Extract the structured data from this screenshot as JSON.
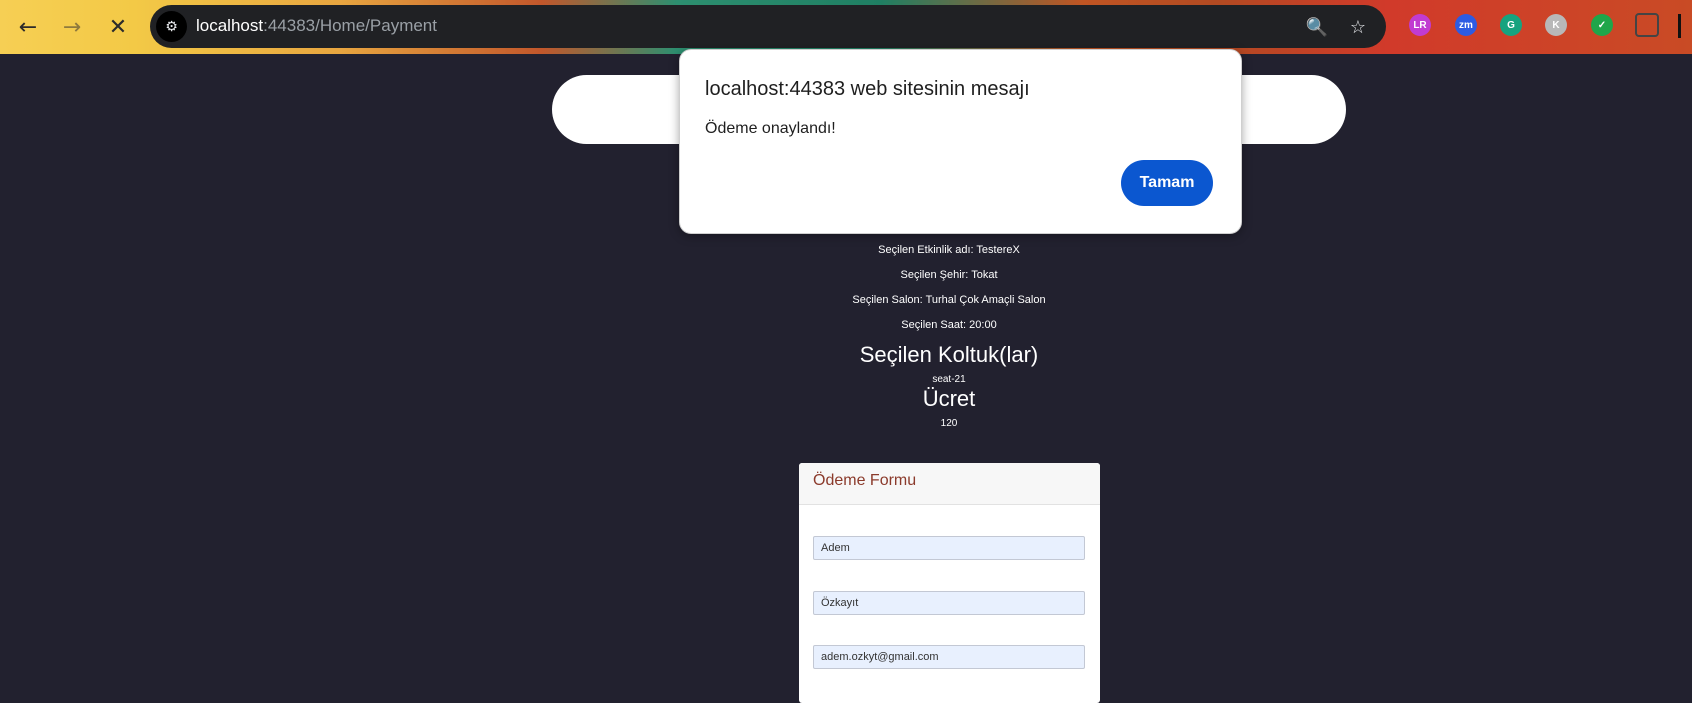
{
  "browser": {
    "url_host": "localhost",
    "url_path": ":44383/Home/Payment",
    "extensions": [
      {
        "name": "lr-extension-icon",
        "label": "LR",
        "color": "#c13bd1"
      },
      {
        "name": "zoom-extension-icon",
        "label": "zm",
        "color": "#2d5be3"
      },
      {
        "name": "grammarly-extension-icon",
        "label": "G",
        "color": "#16a37f"
      },
      {
        "name": "profile-k-extension-icon",
        "label": "K",
        "color": "#b8b8b8"
      },
      {
        "name": "shield-extension-icon",
        "label": "✓",
        "color": "#1fa64a"
      }
    ]
  },
  "event": {
    "name_line": "Seçilen Etkinlik adı: TestereX",
    "city_line": "Seçilen Şehir: Tokat",
    "hall_line": "Seçilen Salon: Turhal Çok Amaçli Salon",
    "time_line": "Seçilen Saat: 20:00",
    "seats_heading": "Seçilen Koltuk(lar)",
    "seats_value": "seat-21",
    "price_heading": "Ücret",
    "price_value": "120"
  },
  "form": {
    "title": "Ödeme Formu",
    "first_name": "Adem",
    "last_name": "Özkayıt",
    "email": "adem.ozkyt@gmail.com"
  },
  "dialog": {
    "title": "localhost:44383 web sitesinin mesajı",
    "message": "Ödeme onaylandı!",
    "ok_label": "Tamam"
  },
  "colors": {
    "page_bg": "#22212f",
    "dialog_button": "#0b57d0",
    "form_title": "#8b3a2b"
  }
}
